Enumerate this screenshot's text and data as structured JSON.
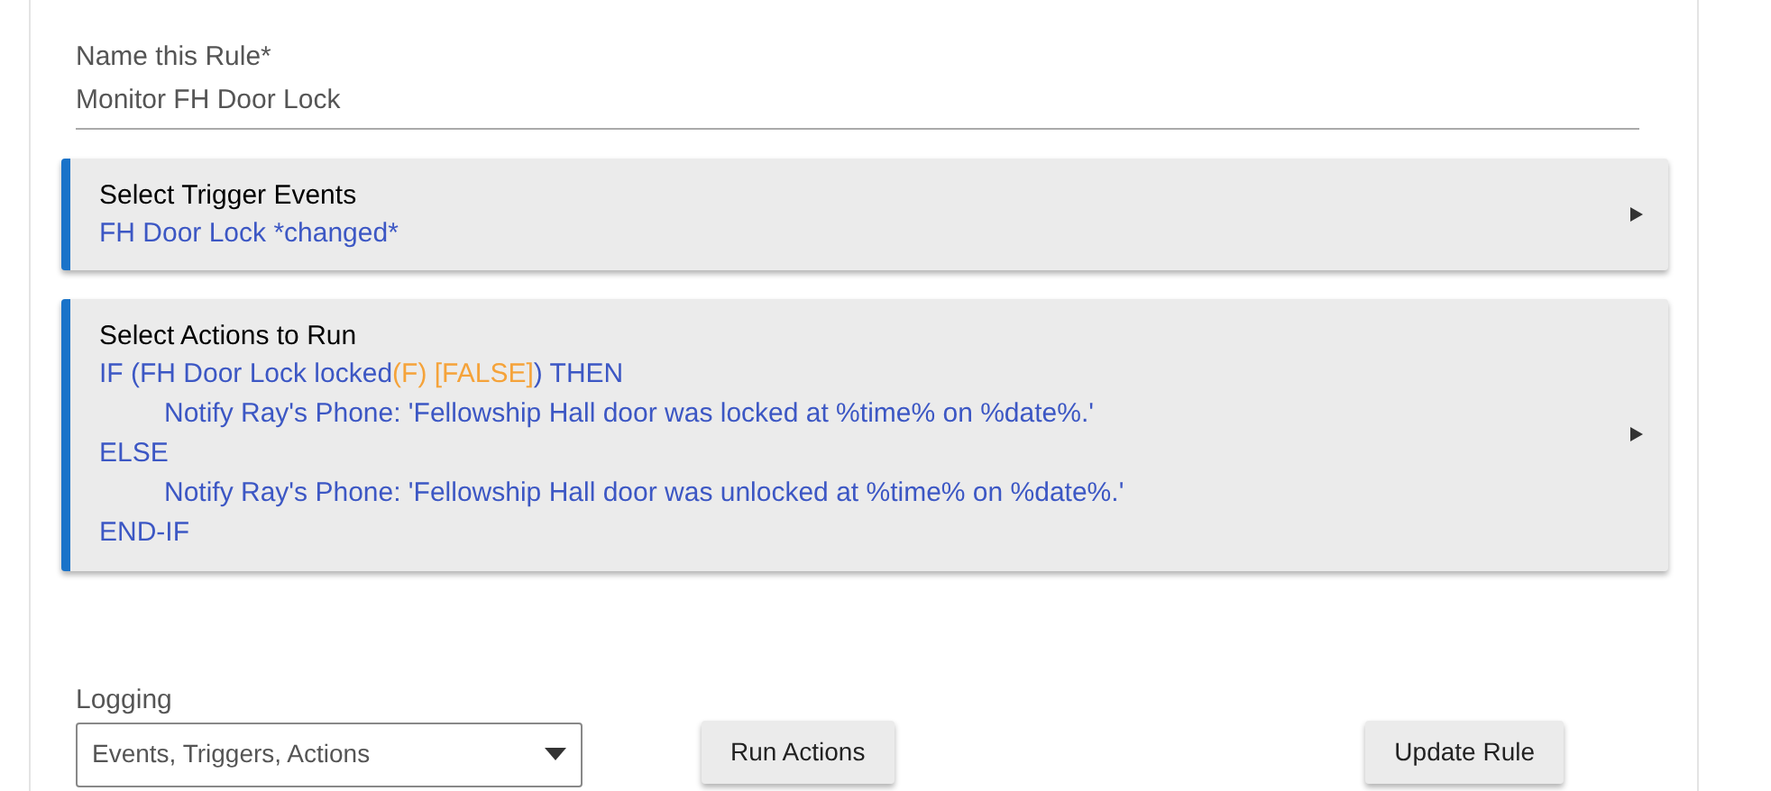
{
  "rule_name": {
    "label": "Name this Rule*",
    "value": "Monitor FH Door Lock"
  },
  "trigger_section": {
    "title": "Select Trigger Events",
    "summary": "FH Door Lock *changed*",
    "expanded": false
  },
  "actions_section": {
    "title": "Select Actions to Run",
    "expanded": false,
    "lines": [
      {
        "segments": [
          {
            "kind": "plain",
            "text": "IF (FH Door Lock locked"
          },
          {
            "kind": "status",
            "text": "(F) [FALSE]"
          },
          {
            "kind": "plain",
            "text": ") THEN"
          }
        ],
        "children": [
          {
            "segments": [
              {
                "kind": "plain",
                "text": "Notify Ray's Phone: 'Fellowship Hall door was locked at %time% on %date%.'"
              }
            ]
          }
        ]
      },
      {
        "segments": [
          {
            "kind": "plain",
            "text": "ELSE"
          }
        ],
        "children": [
          {
            "segments": [
              {
                "kind": "plain",
                "text": "Notify Ray's Phone: 'Fellowship Hall door was unlocked at %time% on %date%.'"
              }
            ]
          }
        ]
      },
      {
        "segments": [
          {
            "kind": "plain",
            "text": "END-IF"
          }
        ]
      }
    ]
  },
  "logging": {
    "label": "Logging",
    "value": "Events, Triggers, Actions"
  },
  "buttons": [
    {
      "label": "Run Actions"
    },
    {
      "label": "Update Rule"
    }
  ]
}
